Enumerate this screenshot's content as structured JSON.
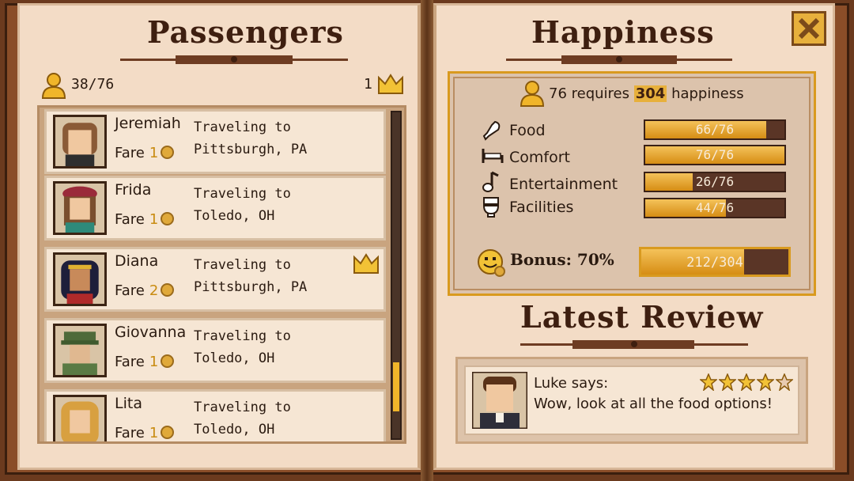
{
  "passengers": {
    "title": "Passengers",
    "count": "38/76",
    "vip_count": "1",
    "list": [
      {
        "name": "Jeremiah",
        "fare_label": "Fare",
        "fare": "1",
        "destination": "Traveling to Pittsburgh, PA",
        "vip": false
      },
      {
        "name": "Frida",
        "fare_label": "Fare",
        "fare": "1",
        "destination": "Traveling to Toledo, OH",
        "vip": false
      },
      {
        "name": "Diana",
        "fare_label": "Fare",
        "fare": "2",
        "destination": "Traveling to Pittsburgh, PA",
        "vip": true
      },
      {
        "name": "Giovanna",
        "fare_label": "Fare",
        "fare": "1",
        "destination": "Traveling to Toledo, OH",
        "vip": false
      },
      {
        "name": "Lita",
        "fare_label": "Fare",
        "fare": "1",
        "destination": "Traveling to Toledo, OH",
        "vip": false
      }
    ]
  },
  "happiness": {
    "title": "Happiness",
    "requirement_count": "76",
    "requirement_mid": "requires",
    "requirement_value": "304",
    "requirement_suffix": "happiness",
    "stats": [
      {
        "label": "Food",
        "value": "66/76",
        "fraction": 0.868,
        "icon": "food-icon"
      },
      {
        "label": "Comfort",
        "value": "76/76",
        "fraction": 1.0,
        "icon": "bed-icon"
      },
      {
        "label": "Entertainment",
        "value": "26/76",
        "fraction": 0.342,
        "icon": "music-note-icon"
      },
      {
        "label": "Facilities",
        "value": "44/76",
        "fraction": 0.579,
        "icon": "toilet-icon"
      }
    ],
    "bonus_label": "Bonus: 70%",
    "bonus_value": "212/304",
    "bonus_fraction": 0.697
  },
  "review": {
    "title": "Latest Review",
    "author_line": "Luke says:",
    "text": "Wow, look at all the food options!",
    "stars": 4,
    "max_stars": 5
  },
  "colors": {
    "page": "#f3dcc6",
    "accent_gold": "#e7b03c",
    "heading": "#3e1f10"
  }
}
